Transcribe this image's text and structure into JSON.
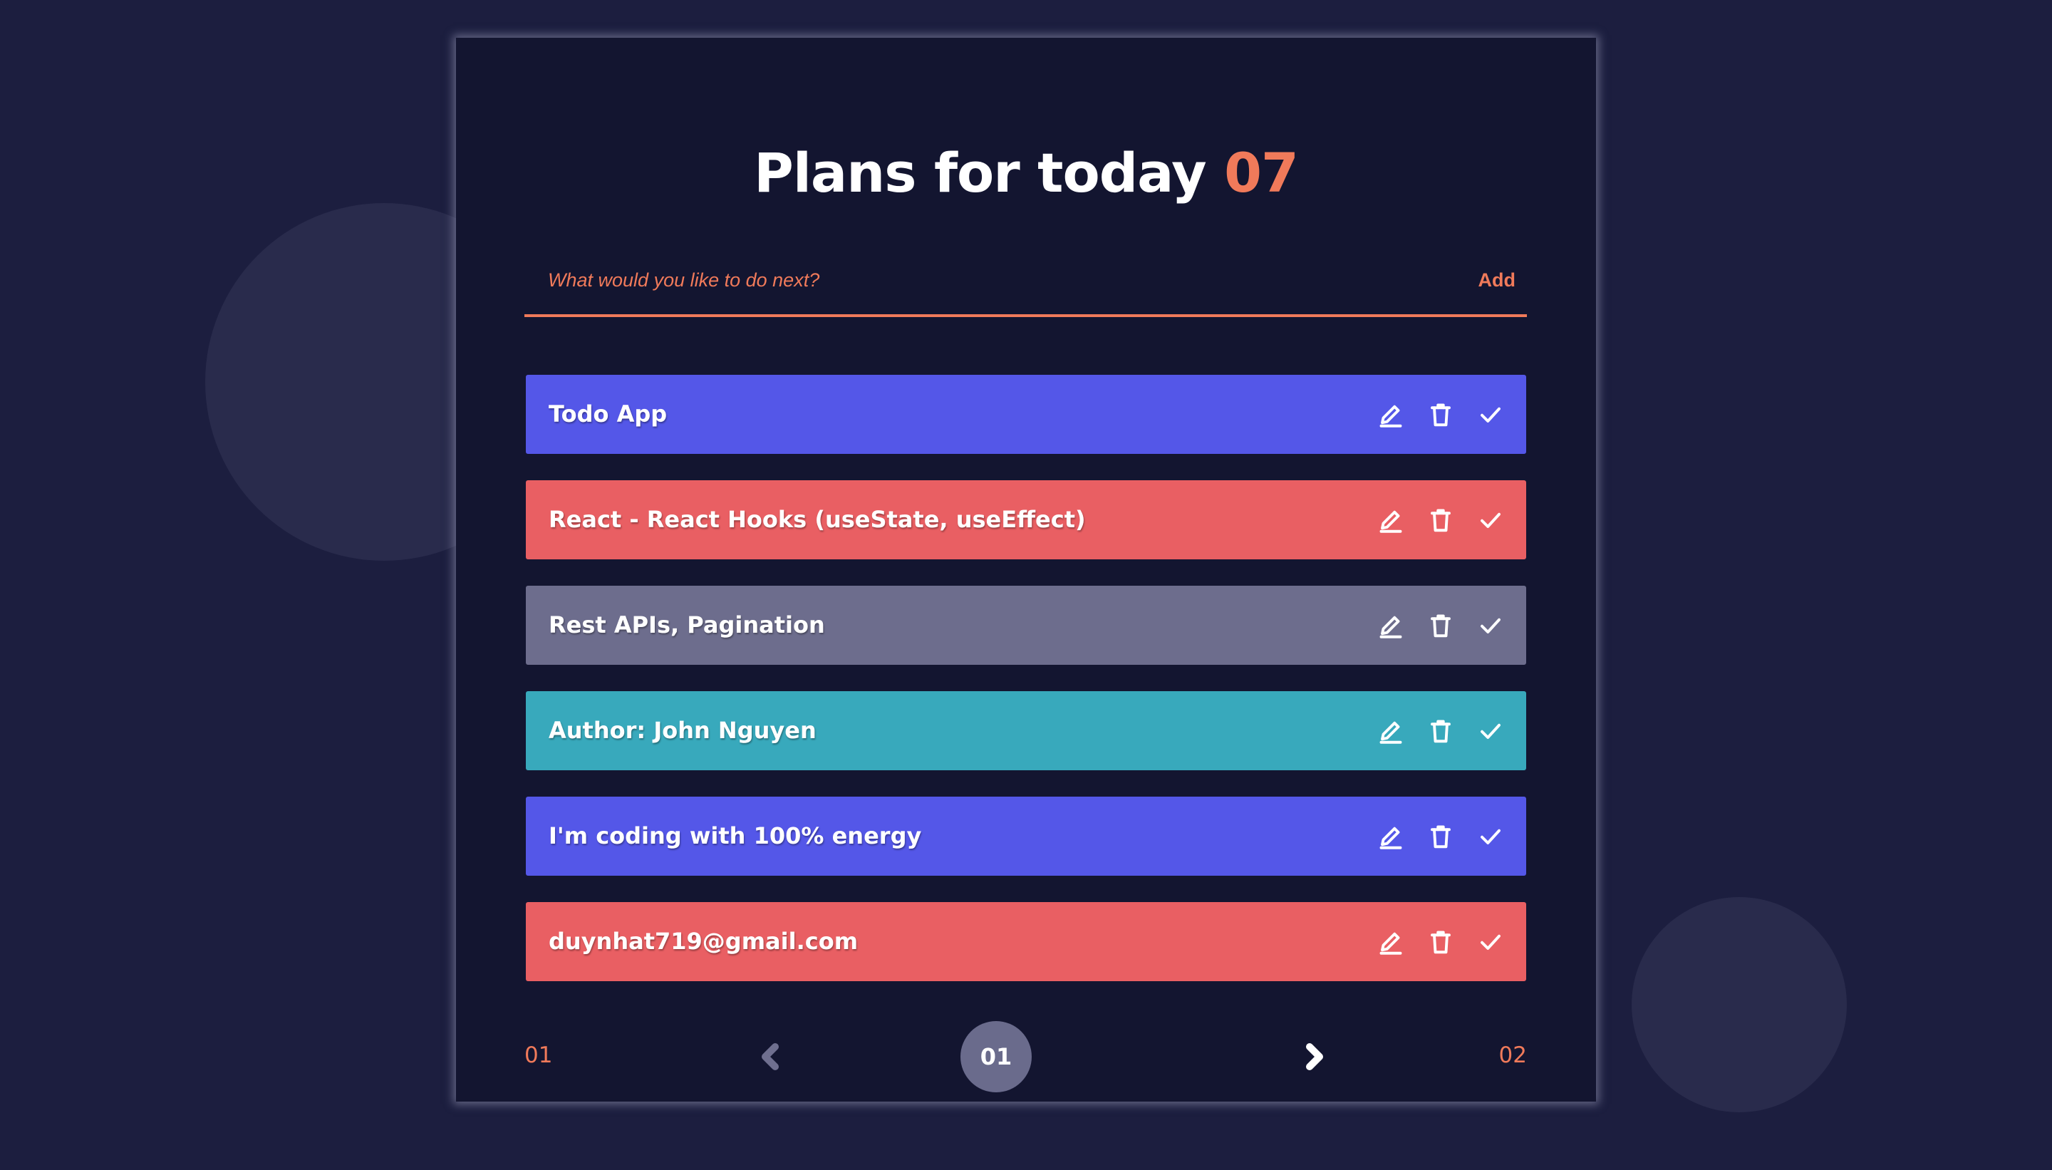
{
  "header": {
    "title": "Plans for today",
    "count": "07"
  },
  "input": {
    "placeholder": "What would you like to do next?",
    "add_label": "Add"
  },
  "todos": [
    {
      "text": "Todo App",
      "color": "#5457e8"
    },
    {
      "text": "React - React Hooks (useState, useEffect)",
      "color": "#e95f63"
    },
    {
      "text": "Rest APIs, Pagination",
      "color": "#6d6d8d"
    },
    {
      "text": "Author: John Nguyen",
      "color": "#38a9bc"
    },
    {
      "text": "I'm coding with 100% energy",
      "color": "#5457e8"
    },
    {
      "text": "duynhat719@gmail.com",
      "color": "#e95f63"
    }
  ],
  "item_actions": {
    "icons": [
      "pencil-icon",
      "trash-icon",
      "check-icon"
    ]
  },
  "pagination": {
    "first": "01",
    "current": "01",
    "last": "02",
    "prev_icon": "chevron-left-icon",
    "next_icon": "chevron-right-icon"
  },
  "colors": {
    "background": "#1c1e3f",
    "card": "#131530",
    "accent": "#f07a5a",
    "page_indicator": "#6a6b8c"
  }
}
